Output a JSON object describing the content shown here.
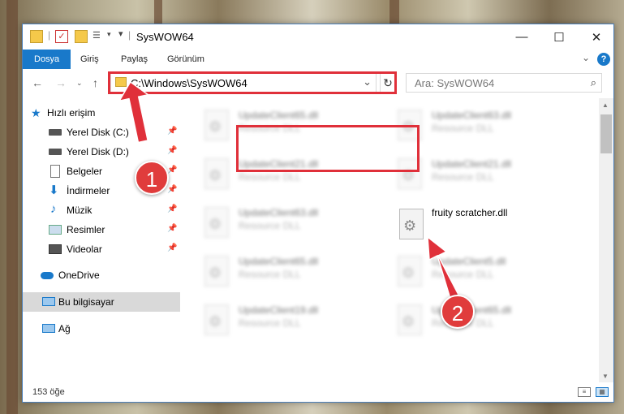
{
  "window": {
    "title": "SysWOW64",
    "controls": {
      "minimize": "—",
      "maximize": "☐",
      "close": "✕"
    }
  },
  "ribbon": {
    "tabs": [
      "Dosya",
      "Giriş",
      "Paylaş",
      "Görünüm"
    ],
    "collapse": "⌄",
    "help": "?"
  },
  "address": {
    "path": "C:\\Windows\\SysWOW64",
    "dropdown": "⌄",
    "refresh": "↻"
  },
  "search": {
    "placeholder": "Ara: SysWOW64",
    "icon": "⌕"
  },
  "nav_pane": {
    "quick_access": "Hızlı erişim",
    "items": [
      {
        "label": "Yerel Disk (C:)",
        "icon": "drive-icon"
      },
      {
        "label": "Yerel Disk (D:)",
        "icon": "drive-icon"
      },
      {
        "label": "Belgeler",
        "icon": "documents-icon"
      },
      {
        "label": "İndirmeler",
        "icon": "download-icon"
      },
      {
        "label": "Müzik",
        "icon": "music-icon"
      },
      {
        "label": "Resimler",
        "icon": "pictures-icon"
      },
      {
        "label": "Videolar",
        "icon": "videos-icon"
      }
    ],
    "onedrive": "OneDrive",
    "this_pc": "Bu bilgisayar",
    "network": "Ağ"
  },
  "files": [
    {
      "name": "UpdateClient65.dll",
      "type": "Resource DLL"
    },
    {
      "name": "UpdateClient63.dll",
      "type": "Resource DLL"
    },
    {
      "name": "UpdateClient21.dll",
      "type": "Resource DLL"
    },
    {
      "name": "UpdateClient21.dll",
      "type": "Resource DLL"
    },
    {
      "name": "UpdateClient63.dll",
      "type": "Resource DLL"
    },
    {
      "name": "fruity scratcher.dll",
      "type": ""
    },
    {
      "name": "UpdateClient65.dll",
      "type": "Resource DLL"
    },
    {
      "name": "UpdateClient5.dll",
      "type": "Resource DLL"
    },
    {
      "name": "UpdateClient19.dll",
      "type": "Resource DLL"
    },
    {
      "name": "UpdateClient65.dll",
      "type": "Resource DLL"
    }
  ],
  "status": {
    "count": "153 öğe"
  },
  "annotations": {
    "step1": "1",
    "step2": "2",
    "color": "#e0303a"
  }
}
